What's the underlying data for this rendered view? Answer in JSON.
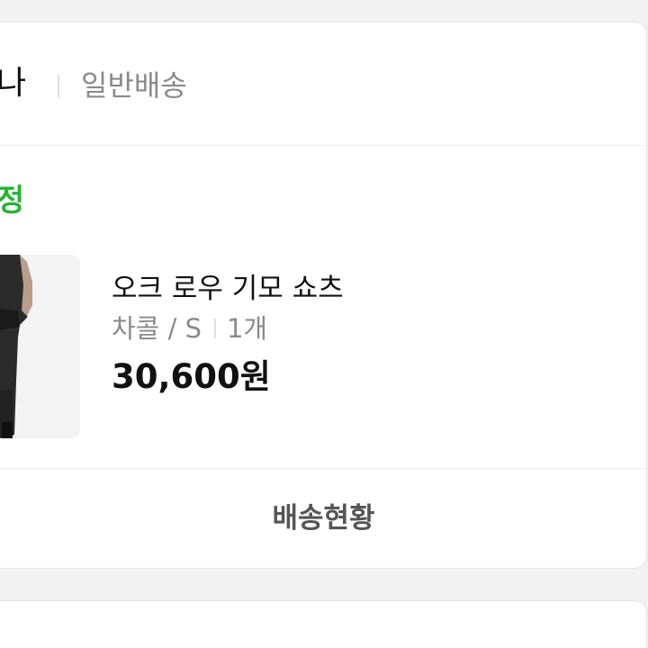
{
  "order": {
    "seller_name": "나",
    "shipping_type": "일반배송",
    "status": "정",
    "status_color": "#22b532",
    "product": {
      "name": "오크 로우 기모 쇼츠",
      "option": "차콜 / S",
      "quantity": "1개",
      "price": "30,600원",
      "image": "product-photo-icon"
    },
    "tracking_button": "배송현황"
  },
  "colors": {
    "background": "#f2f2f2",
    "card": "#ffffff",
    "muted_text": "#8a8a8a",
    "button_text": "#555555"
  }
}
